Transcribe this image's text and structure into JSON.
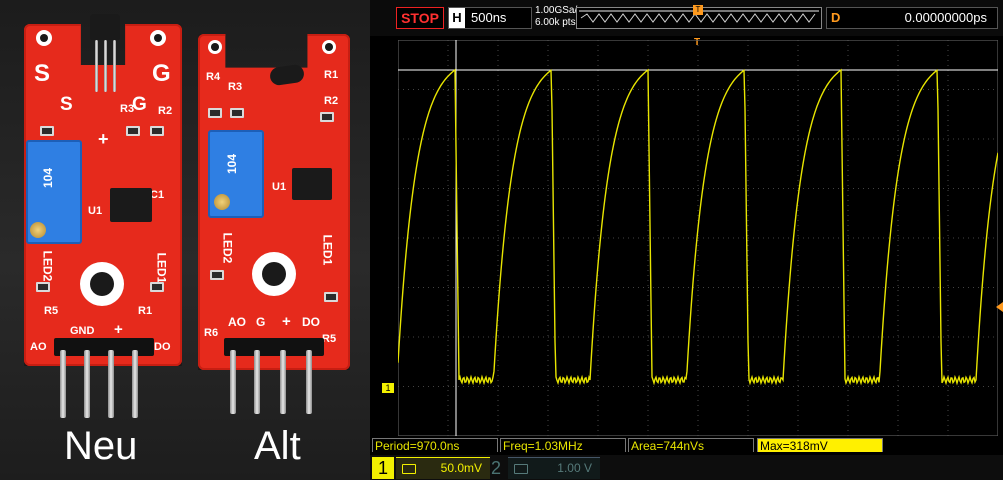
{
  "photo": {
    "left_board_label": "Neu",
    "right_board_label": "Alt",
    "new_board": {
      "top_pins": [
        "S",
        "G"
      ],
      "lower_pins": [
        "S",
        "G"
      ],
      "pot_text": "104",
      "side_labels": [
        "R3",
        "R2",
        "C1",
        "U1",
        "LED2",
        "R5",
        "LED1",
        "R1"
      ],
      "header_labels": [
        "AO",
        "GND",
        "+",
        "DO"
      ],
      "plus_mark": "+"
    },
    "old_board": {
      "top_labels": [
        "R4",
        "R3",
        "R1",
        "R2"
      ],
      "pot_text": "104",
      "side_labels": [
        "LED2",
        "LED1",
        "U1",
        "R6",
        "R5"
      ],
      "header_labels": [
        "AO",
        "G",
        "+",
        "DO"
      ]
    },
    "colors": {
      "pcb": "#e62a1c",
      "pot": "#2f7fe3"
    }
  },
  "scope": {
    "run_state": "STOP",
    "horizontal_letter": "H",
    "timebase": "500ns",
    "sample_rate": "1.00GSa/s",
    "memory_depth": "6.00k pts",
    "trigger_marker": "T",
    "delay_letter": "D",
    "delay": "0.00000000ps",
    "channel_marker": "1",
    "measurements": [
      {
        "label": "Period=970.0ns"
      },
      {
        "label": "Freq=1.03MHz"
      },
      {
        "label": "Area=744nVs"
      },
      {
        "label": "Max=318mV",
        "highlighted": true
      }
    ],
    "ch1": {
      "number": "1",
      "scale": "50.0mV",
      "active": true
    },
    "ch2": {
      "number": "2",
      "scale": "1.00 V",
      "active": false
    },
    "colors": {
      "trace": "#e8e500",
      "stop": "#ff3030",
      "trigger": "#ff9a1e"
    }
  }
}
